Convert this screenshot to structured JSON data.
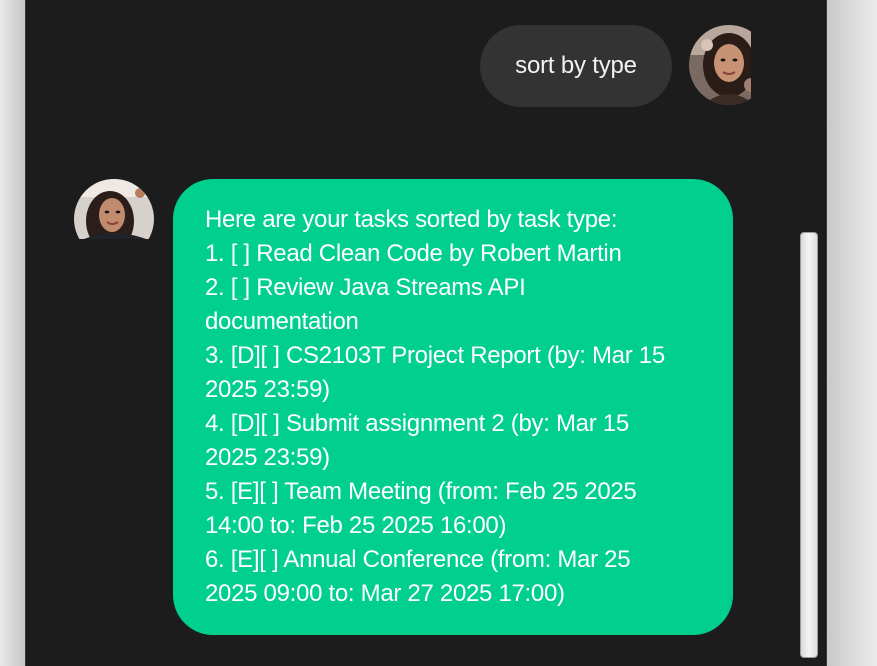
{
  "chat": {
    "user_message": "sort by type",
    "bot_message_lines": [
      "Here are your tasks sorted by task type:",
      "1. [ ] Read Clean Code by Robert Martin",
      "2. [ ] Review Java Streams API",
      "documentation",
      "3. [D][ ] CS2103T Project Report (by: Mar 15",
      "2025 23:59)",
      "4. [D][ ] Submit assignment 2 (by: Mar 15",
      "2025 23:59)",
      "5. [E][ ] Team Meeting (from: Feb 25 2025",
      "14:00 to: Feb 25 2025 16:00)",
      "6. [E][ ] Annual Conference (from: Mar 25",
      "2025 09:00 to: Mar 27 2025 17:00)"
    ]
  },
  "colors": {
    "background": "#1c1c1c",
    "user_bubble": "#333333",
    "bot_bubble": "#00cf8d",
    "text": "#ffffff"
  },
  "icons": {
    "user_avatar": "user-avatar-photo",
    "bot_avatar": "bot-avatar-photo"
  }
}
